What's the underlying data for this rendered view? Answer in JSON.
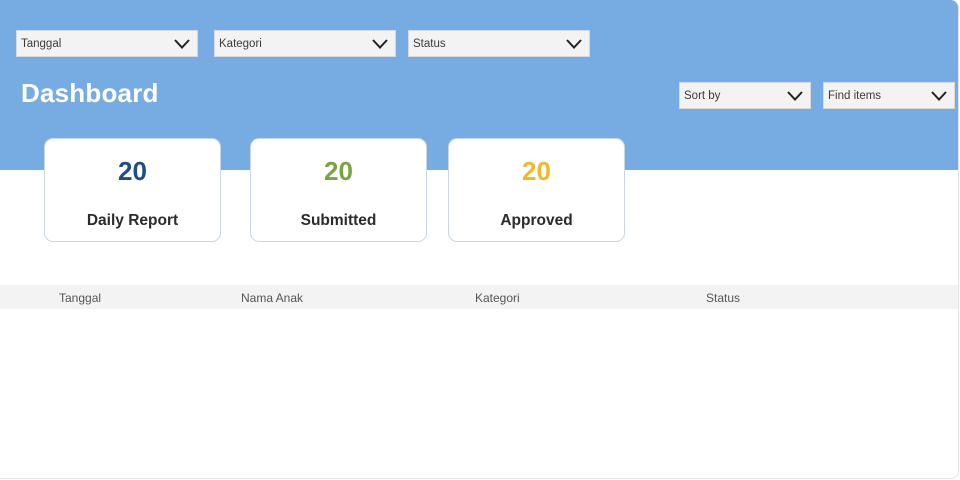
{
  "filters": {
    "tanggal": "Tanggal",
    "kategori": "Kategori",
    "status": "Status"
  },
  "header": {
    "title": "Dashboard",
    "sort_by": "Sort by",
    "find_items": "Find items"
  },
  "cards": [
    {
      "value": "20",
      "label": "Daily Report",
      "color": "#1f4e86"
    },
    {
      "value": "20",
      "label": "Submitted",
      "color": "#7aa443"
    },
    {
      "value": "20",
      "label": "Approved",
      "color": "#f0b72f"
    }
  ],
  "table": {
    "columns": [
      "Tanggal",
      "Nama Anak",
      "Kategori",
      "Status"
    ]
  },
  "colors": {
    "header_band": "#77ace2",
    "card_border": "#c9d7e6"
  }
}
